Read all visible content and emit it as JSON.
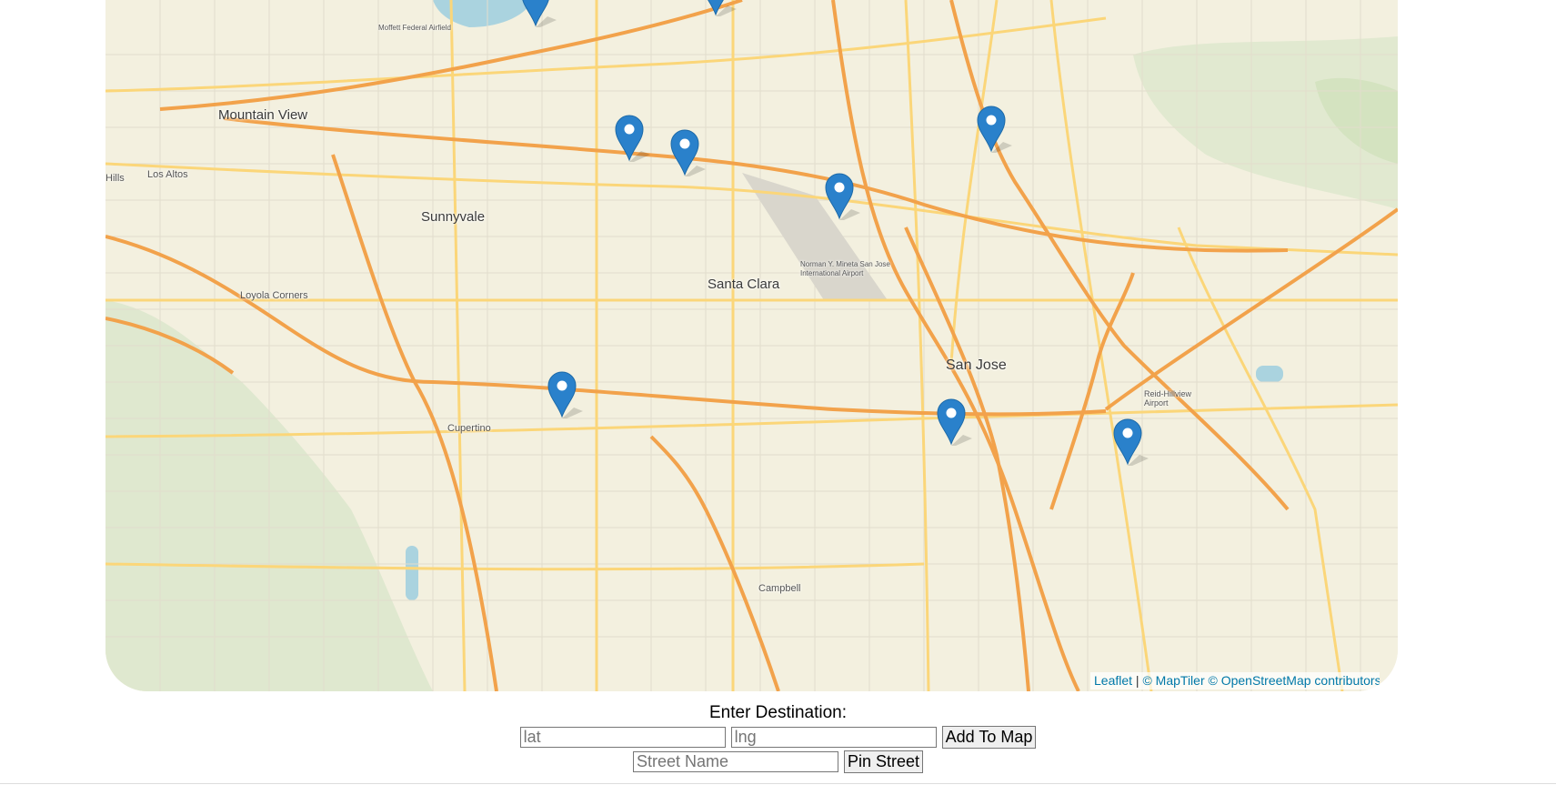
{
  "map": {
    "places": [
      {
        "name": "Mountain View",
        "kind": "city"
      },
      {
        "name": "Los Altos",
        "kind": "town"
      },
      {
        "name": "Sunnyvale",
        "kind": "city"
      },
      {
        "name": "Santa Clara",
        "kind": "city"
      },
      {
        "name": "San Jose",
        "kind": "big"
      },
      {
        "name": "Cupertino",
        "kind": "town"
      },
      {
        "name": "Campbell",
        "kind": "town"
      },
      {
        "name": "Loyola Corners",
        "kind": "town"
      },
      {
        "name": "Moffett Federal Airfield",
        "kind": "town"
      },
      {
        "name": "Norman Y. Mineta San Jose International Airport",
        "kind": "town"
      },
      {
        "name": "Reid-Hillview Airport",
        "kind": "town"
      },
      {
        "name": "Hills",
        "kind": "town"
      }
    ],
    "marker_icon": "map-pin-icon",
    "marker_color": "#2a81cb",
    "marker_count": 10
  },
  "attribution": {
    "leaflet": "Leaflet",
    "separator": " | ",
    "maptiler": "© MapTiler",
    "osm": "© OpenStreetMap contributors"
  },
  "form": {
    "title": "Enter Destination:",
    "lat_placeholder": "lat",
    "lng_placeholder": "lng",
    "add_button": "Add To Map",
    "street_placeholder": "Street Name",
    "pin_button": "Pin Street"
  }
}
